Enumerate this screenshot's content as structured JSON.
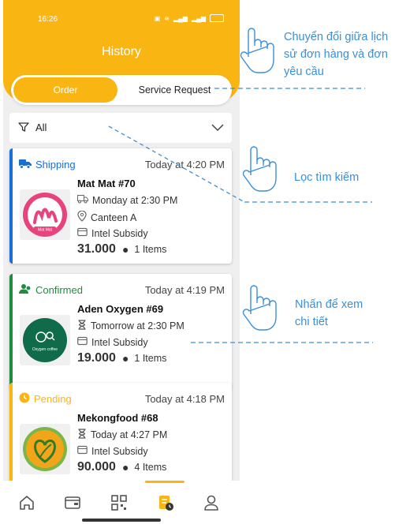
{
  "statusbar": {
    "time": "16:26"
  },
  "header": {
    "title": "History"
  },
  "tabs": {
    "order": "Order",
    "service": "Service Request"
  },
  "filter": {
    "value": "All"
  },
  "orders": [
    {
      "status": "Shipping",
      "status_color": "#1a6ed8",
      "time": "Today at 4:20 PM",
      "name": "Mat Mat #70",
      "schedule": "Monday at 2:30 PM",
      "location": "Canteen A",
      "payment": "Intel Subsidy",
      "amount": "31.000",
      "items": "1 Items"
    },
    {
      "status": "Confirmed",
      "status_color": "#1e8e3e",
      "time": "Today at 4:19 PM",
      "name": "Aden Oxygen #69",
      "schedule": "Tomorrow at 2:30 PM",
      "payment": "Intel Subsidy",
      "amount": "19.000",
      "items": "1 Items"
    },
    {
      "status": "Pending",
      "status_color": "#f9b613",
      "time": "Today at 4:18 PM",
      "name": "Mekongfood #68",
      "schedule": "Today at 4:27 PM",
      "payment": "Intel Subsidy",
      "amount": "90.000",
      "items": "4 Items"
    }
  ],
  "logos": {
    "matmat": "Mat Mat",
    "oxygen": "Oxygen coffee"
  },
  "annotations": {
    "switch": [
      "Chuyển đổi giữa lịch",
      "sử đơn hàng và đơn",
      "yêu cầu"
    ],
    "filter": "Lọc tìm kiếm",
    "detail": [
      "Nhấn để xem",
      "chi tiết"
    ]
  },
  "colors": {
    "accent": "#f9b613",
    "annotation": "#3a8fd8"
  }
}
